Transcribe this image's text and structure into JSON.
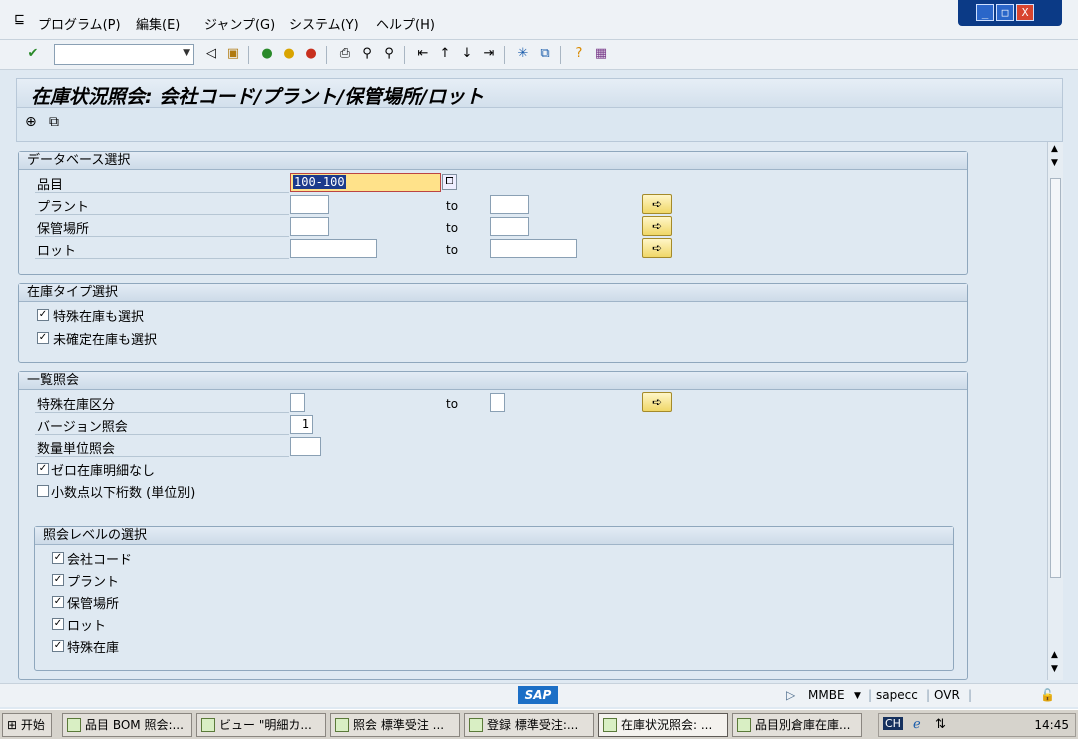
{
  "menu": {
    "items": [
      "プログラム(P)",
      "編集(E)",
      "ジャンプ(G)",
      "システム(Y)",
      "ヘルプ(H)"
    ],
    "window_buttons": [
      "_",
      "□",
      "X"
    ]
  },
  "toolbar": {
    "command_field_value": "",
    "icons": [
      "check-icon",
      "back-icon",
      "save-icon",
      "back-green-icon",
      "exit-icon",
      "cancel-icon",
      "print-icon",
      "find-icon",
      "find-next-icon",
      "first-page-icon",
      "prev-page-icon",
      "next-page-icon",
      "last-page-icon",
      "new-session-icon",
      "shortcut-icon",
      "help-icon",
      "layout-icon"
    ]
  },
  "title": "在庫状況照会: 会社コード/プラント/保管場所/ロット",
  "app_toolbar": {
    "icons": [
      "execute-icon",
      "variant-icon"
    ]
  },
  "db_select": {
    "header": "データベース選択",
    "material_label": "品目",
    "material_value": "100-100",
    "plant_label": "プラント",
    "sloc_label": "保管場所",
    "batch_label": "ロット",
    "to": "to"
  },
  "stock_type": {
    "header": "在庫タイプ選択",
    "special": {
      "label": "特殊在庫も選択",
      "checked": true
    },
    "unconfirmed": {
      "label": "未確定在庫も選択",
      "checked": true
    }
  },
  "list_display": {
    "header": "一覧照会",
    "special_ind_label": "特殊在庫区分",
    "version_label": "バージョン照会",
    "version_value": "1",
    "unit_label": "数量単位照会",
    "no_zero": {
      "label": "ゼロ在庫明細なし",
      "checked": true
    },
    "decimals": {
      "label": "小数点以下桁数 (単位別)",
      "checked": false
    },
    "to": "to"
  },
  "levels": {
    "header": "照会レベルの選択",
    "items": [
      {
        "label": "会社コード",
        "checked": true
      },
      {
        "label": "プラント",
        "checked": true
      },
      {
        "label": "保管場所",
        "checked": true
      },
      {
        "label": "ロット",
        "checked": true
      },
      {
        "label": "特殊在庫",
        "checked": true
      }
    ]
  },
  "status": {
    "logo": "SAP",
    "transaction": "MMBE",
    "server": "sapecc",
    "mode": "OVR"
  },
  "taskbar": {
    "start": "开始",
    "tasks": [
      "品目 BOM 照会:...",
      "ビュー \"明細カ...",
      "照会 標準受注 ...",
      "登録 標準受注:...",
      "在庫状況照会: ...",
      "品目別倉庫在庫..."
    ],
    "tray_text": "CH",
    "clock": "14:45"
  }
}
